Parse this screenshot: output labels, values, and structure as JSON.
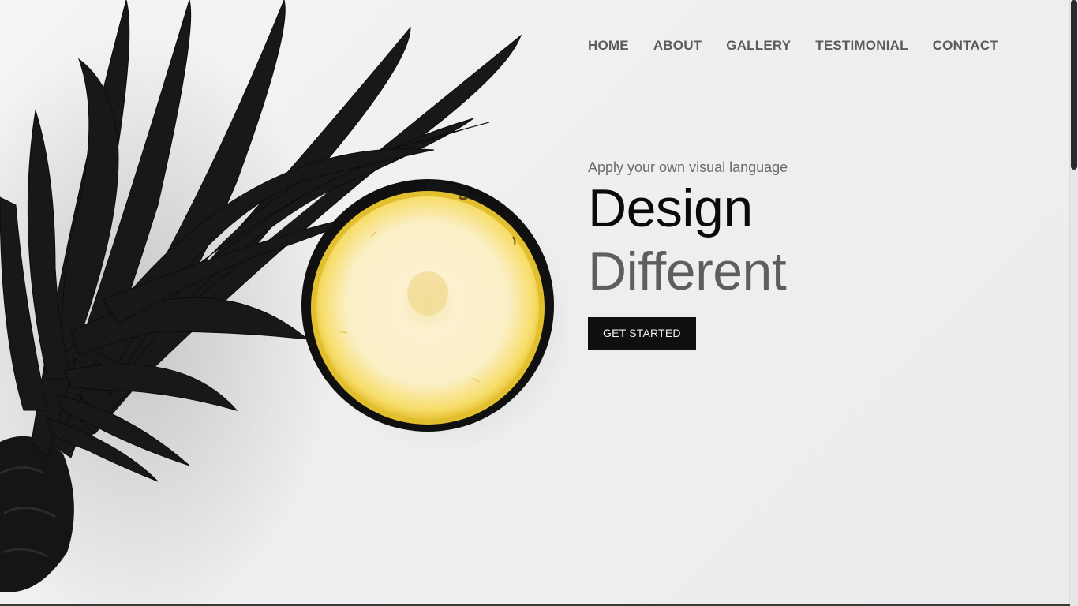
{
  "nav": {
    "items": [
      {
        "label": "HOME"
      },
      {
        "label": "ABOUT"
      },
      {
        "label": "GALLERY"
      },
      {
        "label": "TESTIMONIAL"
      },
      {
        "label": "CONTACT"
      }
    ]
  },
  "hero": {
    "tagline": "Apply your own visual language",
    "title_line1": "Design",
    "title_line2": "Different",
    "cta_label": "GET STARTED",
    "image_icon": "pineapple-image"
  },
  "colors": {
    "background": "#f0f0f1",
    "nav_text": "#5b5b5b",
    "title_dark": "#0a0a0a",
    "title_gray": "#5e5e5e",
    "button_bg": "#0f0f0f",
    "button_text": "#f2f2f2",
    "fruit_yellow": "#f7e27a"
  }
}
